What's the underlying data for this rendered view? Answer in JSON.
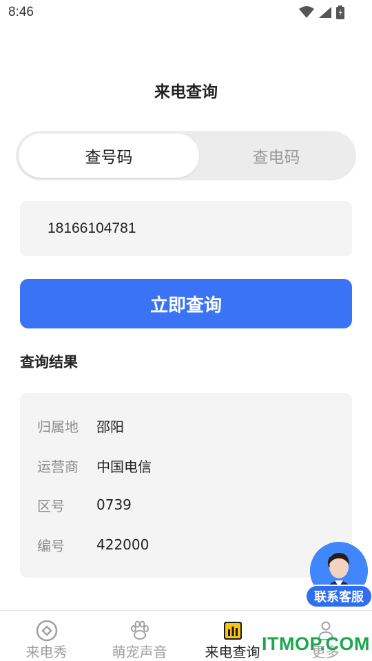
{
  "status_bar": {
    "time": "8:46"
  },
  "page": {
    "title": "来电查询"
  },
  "segmented": {
    "tab_number": "查号码",
    "tab_phone": "查电码"
  },
  "search": {
    "value": "18166104781"
  },
  "actions": {
    "query_label": "立即查询"
  },
  "results": {
    "title": "查询结果",
    "rows": [
      {
        "label": "归属地",
        "value": "邵阳"
      },
      {
        "label": "运营商",
        "value": "中国电信"
      },
      {
        "label": "区号",
        "value": "0739"
      },
      {
        "label": "编号",
        "value": "422000"
      }
    ]
  },
  "customer_service": {
    "label": "联系客服"
  },
  "tabbar": {
    "items": [
      {
        "label": "来电秀",
        "icon": "diamond-circle-icon",
        "active": false
      },
      {
        "label": "萌宠声音",
        "icon": "paw-icon",
        "active": false
      },
      {
        "label": "来电查询",
        "icon": "chart-icon",
        "active": true
      },
      {
        "label": "更多",
        "icon": "person-icon",
        "active": false
      }
    ]
  },
  "watermark": "ITMOP.COM",
  "colors": {
    "accent": "#3a73f5",
    "card_bg": "#f4f4f4",
    "watermark": "#1aa84a"
  }
}
